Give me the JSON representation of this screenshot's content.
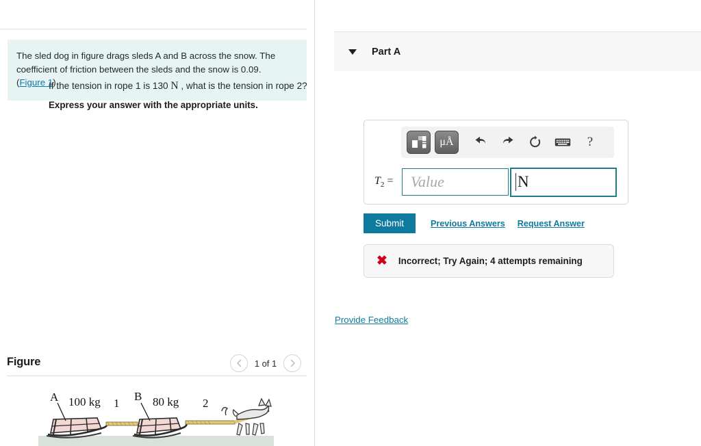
{
  "problem": {
    "text": "The sled dog in figure drags sleds A and B across the snow. The coefficient of friction between the sleds and the snow is 0.09.",
    "open_paren": "(",
    "figure_link": "Figure 1",
    "close_paren": ")"
  },
  "figure_panel": {
    "title": "Figure",
    "counter": "1 of 1",
    "prev_icon": "chevron-left-icon",
    "next_icon": "chevron-right-icon",
    "image": {
      "sled_a_label": "A",
      "sled_a_mass": "100 kg",
      "rope_1_label": "1",
      "sled_b_label": "B",
      "sled_b_mass": "80 kg",
      "rope_2_label": "2"
    }
  },
  "part": {
    "title": "Part A",
    "caret_icon": "caret-down-icon",
    "question_pre": "If the tension in rope 1 is 130",
    "question_unit": "N",
    "question_post": ", what is the tension in rope 2?",
    "instruction": "Express your answer with the appropriate units."
  },
  "answer_widget": {
    "toolbar": {
      "template_button": "math-template-icon",
      "units_button": "μÅ",
      "undo_icon": "undo-icon",
      "redo_icon": "redo-icon",
      "reset_icon": "reset-icon",
      "keyboard_icon": "keyboard-icon",
      "help_label": "?"
    },
    "variable": "T",
    "subscript": "2",
    "equals": "=",
    "value_placeholder": "Value",
    "unit_value": "N"
  },
  "actions": {
    "submit_label": "Submit",
    "previous_answers_label": "Previous Answers",
    "request_answer_label": "Request Answer"
  },
  "feedback_banner": {
    "icon": "x-mark-icon",
    "symbol": "✖",
    "message": "Incorrect; Try Again; 4 attempts remaining"
  },
  "footer": {
    "provide_feedback_label": "Provide Feedback"
  },
  "colors": {
    "problem_bg": "#e6f4f3",
    "link": "#0e7a9e",
    "submit_bg": "#0e7a9e",
    "error_red": "#d0021b",
    "field_border": "#1f7a8c",
    "part_header_bg": "#f7f7f7"
  }
}
